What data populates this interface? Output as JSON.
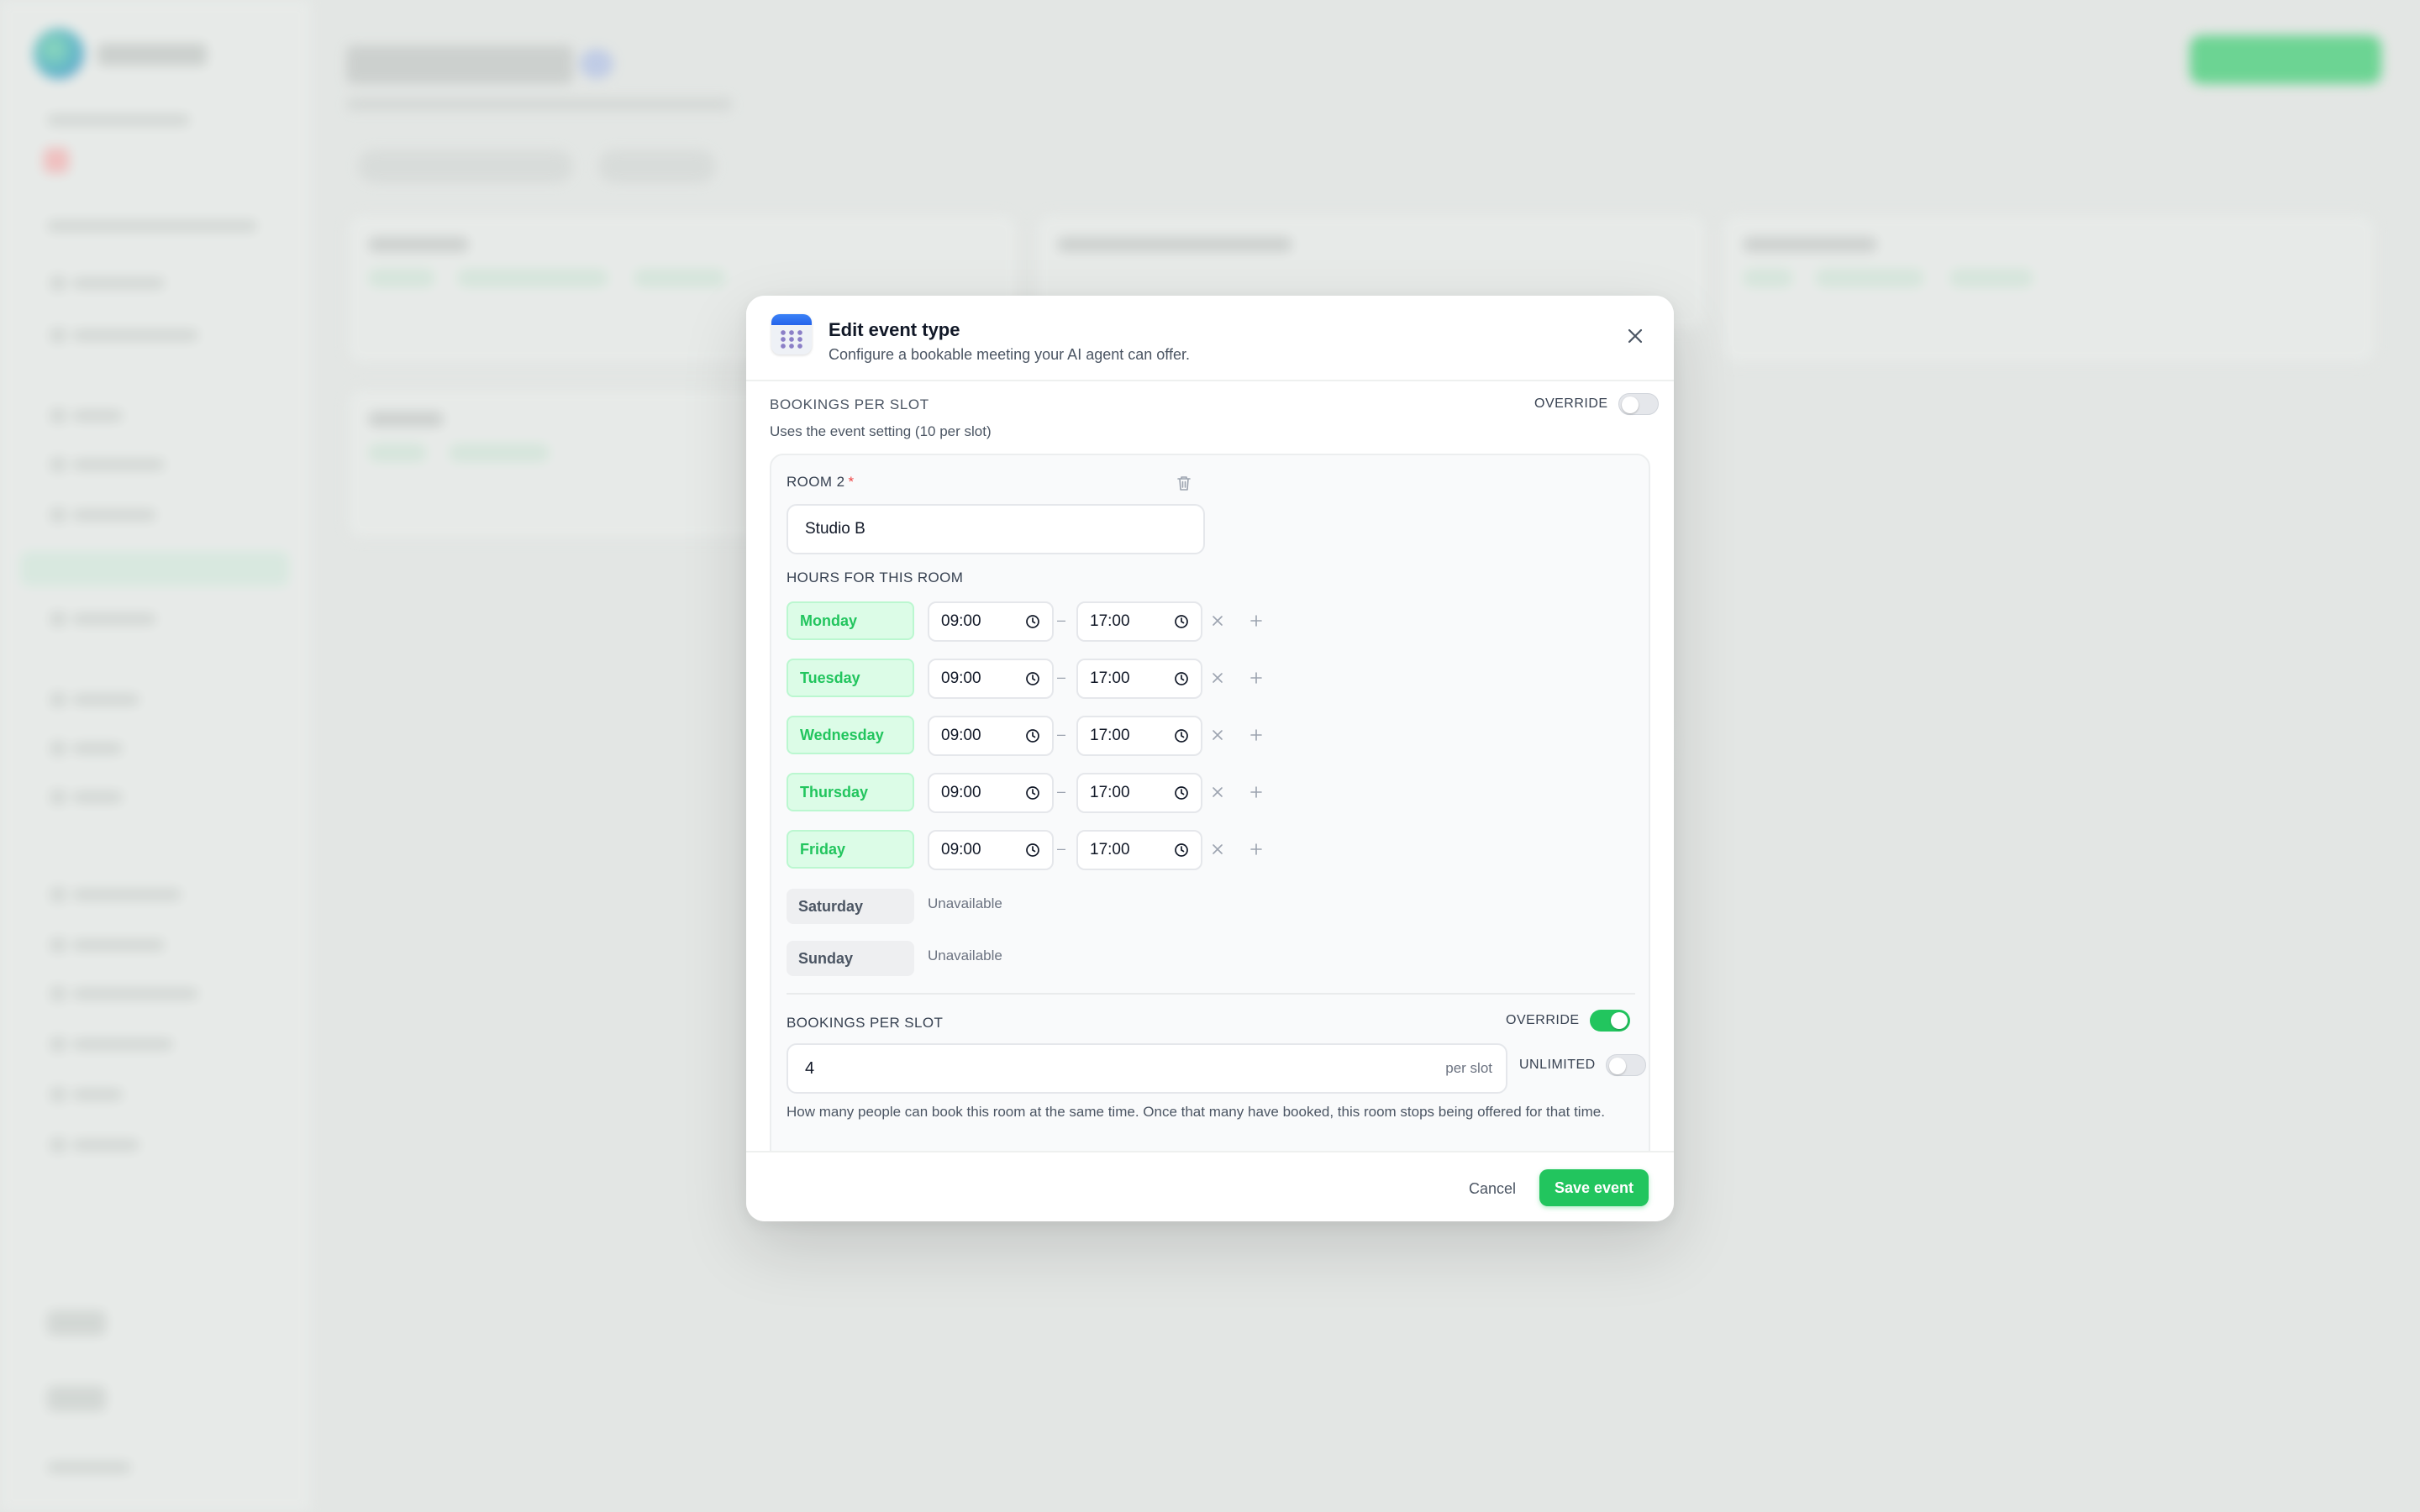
{
  "modal": {
    "title": "Edit event type",
    "subtitle": "Configure a bookable meeting your AI agent can offer.",
    "event_bookings": {
      "label": "BOOKINGS PER SLOT",
      "override_label": "OVERRIDE",
      "override_on": false,
      "description": "Uses the event setting (10 per slot)"
    },
    "room": {
      "label": "ROOM 2",
      "required_mark": "*",
      "name_value": "Studio B",
      "hours_label": "HOURS FOR THIS ROOM",
      "separator": "–",
      "unavailable_text": "Unavailable",
      "days": [
        {
          "name": "Monday",
          "enabled": true,
          "start": "09:00",
          "end": "17:00"
        },
        {
          "name": "Tuesday",
          "enabled": true,
          "start": "09:00",
          "end": "17:00"
        },
        {
          "name": "Wednesday",
          "enabled": true,
          "start": "09:00",
          "end": "17:00"
        },
        {
          "name": "Thursday",
          "enabled": true,
          "start": "09:00",
          "end": "17:00"
        },
        {
          "name": "Friday",
          "enabled": true,
          "start": "09:00",
          "end": "17:00"
        },
        {
          "name": "Saturday",
          "enabled": false
        },
        {
          "name": "Sunday",
          "enabled": false
        }
      ],
      "bookings": {
        "label": "BOOKINGS PER SLOT",
        "override_label": "OVERRIDE",
        "override_on": true,
        "value": "4",
        "unit": "per slot",
        "unlimited_label": "UNLIMITED",
        "unlimited_on": false,
        "help": "How many people can book this room at the same time. Once that many have booked, this room stops being offered for that time."
      }
    },
    "footer": {
      "cancel_label": "Cancel",
      "save_label": "Save event"
    }
  },
  "colors": {
    "accent": "#22c55e",
    "accent_light": "#dcfce7",
    "required": "#ef4444"
  },
  "icons": {
    "header": "calendar-icon",
    "close": "close-icon",
    "delete": "trash-icon",
    "time": "clock-icon",
    "remove": "x-icon",
    "add": "plus-icon"
  }
}
